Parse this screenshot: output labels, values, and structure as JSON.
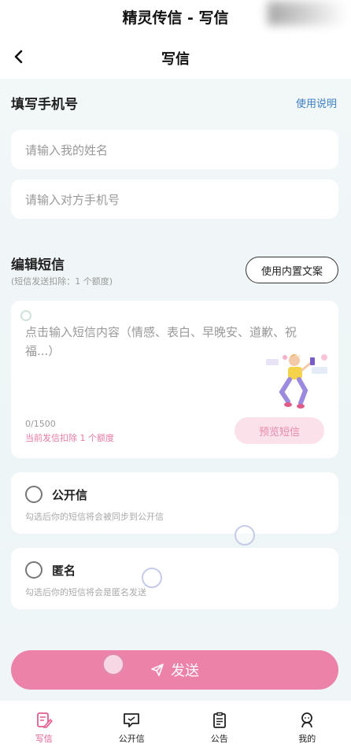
{
  "status_bar": {
    "title": "精灵传信 - 写信"
  },
  "nav": {
    "title": "写信"
  },
  "phone_section": {
    "title": "填写手机号",
    "help_link": "使用说明",
    "name_placeholder": "请输入我的姓名",
    "phone_placeholder": "请输入对方手机号"
  },
  "sms_section": {
    "title": "编辑短信",
    "note": "(短信发送扣除：1 个额度)",
    "template_button": "使用内置文案",
    "content_placeholder": "点击输入短信内容（情感、表白、早晚安、道歉、祝福...）",
    "counter": "0/1500",
    "deduct_note": "当前发信扣除 1 个额度",
    "preview_button": "预览短信"
  },
  "options": [
    {
      "label": "公开信",
      "desc": "勾选后你的短信将会被同步到公开信",
      "checked": false
    },
    {
      "label": "匿名",
      "desc": "勾选后你的短信将会是匿名发送",
      "checked": false
    }
  ],
  "send_button": "发送",
  "tabbar": [
    {
      "label": "写信",
      "icon": "write-icon",
      "active": true
    },
    {
      "label": "公开信",
      "icon": "message-icon",
      "active": false
    },
    {
      "label": "公告",
      "icon": "clipboard-icon",
      "active": false
    },
    {
      "label": "我的",
      "icon": "user-icon",
      "active": false
    }
  ],
  "colors": {
    "accent_pink": "#ec82a8",
    "link_blue": "#3b7fc4",
    "background": "#eef5f6"
  }
}
